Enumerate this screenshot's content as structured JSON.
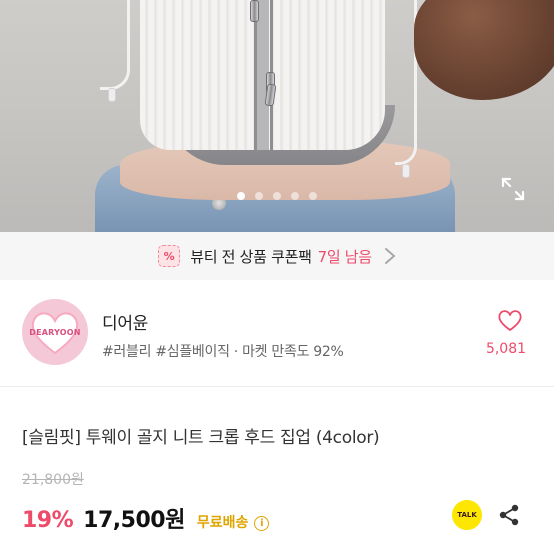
{
  "coupon": {
    "icon": "coupon-percent-icon",
    "icon_glyph": "%",
    "text": "뷰티 전 상품 쿠폰팩",
    "days_left": "7일 남음"
  },
  "shop": {
    "avatar_text": "DEARYOON",
    "name": "디어윤",
    "tags": "#러블리 #심플베이직 · 마켓 만족도 92%",
    "like_count": "5,081"
  },
  "product": {
    "title": "[슬림핏] 투웨이 골지 니트 크롭 후드 집업 (4color)",
    "original_price": "21,800원",
    "discount": "19%",
    "sale_price": "17,500원",
    "shipping": "무료배송",
    "info_glyph": "i"
  },
  "actions": {
    "talk_label": "TALK"
  },
  "carousel": {
    "slide_count": 5,
    "active_index": 0
  },
  "colors": {
    "accent_pink": "#ee4b6a",
    "shipping_gold": "#e0a400",
    "kakao_yellow": "#fde600"
  }
}
